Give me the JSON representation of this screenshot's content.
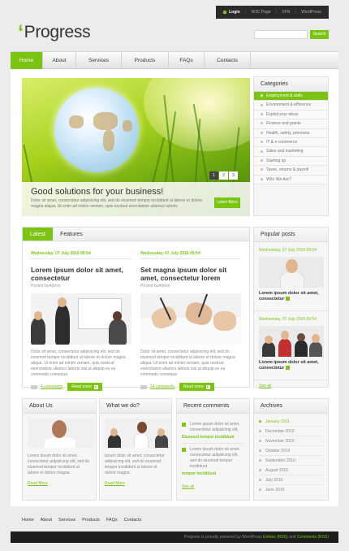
{
  "topbar": {
    "login": "Login",
    "links": [
      "W3C Page",
      "XFN",
      "WordPress"
    ]
  },
  "logo": {
    "mark": "‘",
    "text": "Progress"
  },
  "search": {
    "button": "Search",
    "placeholder": ""
  },
  "nav": [
    "Home",
    "About",
    "Services",
    "Products",
    "FAQs",
    "Contacts"
  ],
  "slider": {
    "title": "Good solutions for your business!",
    "text": "Dolor sit amet, consectetur adipisicing elit, sed do eiusmod tempor incididunt ut labore et dolore magna aliqua. Ut enim ad minim veniam, quis nostrud exercitation ullamco laboris",
    "button": "Learn More",
    "pages": [
      "1",
      "2",
      "3"
    ]
  },
  "categories": {
    "title": "Categories",
    "items": [
      "Employment & skills",
      "Environment & efficience",
      "Exploit your ideas",
      "Finance and grants",
      "Health, safety, premises",
      "IT & e-commerce",
      "Sales and marketing",
      "Starting up",
      "Taxes, returns & payroll",
      "Who We Are?"
    ]
  },
  "tabs": [
    "Latest",
    "Features"
  ],
  "posts": [
    {
      "date": "Wednesday, 07 July 2010 09:54",
      "title": "Lorem ipsum dolor sit amet, consectetur",
      "by": "Posted byAdmin",
      "text": "Dolor sit amet, consectetur adipisicing elit, sed do eiusmod tempor incididunt ut labore et dolore magna aliqua. Ut enim ad minim veniam, quis nostrud exercitation ullamco laboris nisi ut aliquip ex ea commodo consequa",
      "comments": "4 comments",
      "more": "Read more"
    },
    {
      "date": "Wednesday, 07 July 2010 09:54",
      "title": "Set magna ipsum dolor sit amet, consectetur lorem",
      "by": "Posted byAdmin",
      "text": "Dolor sit amet, consectetur adipisicing elit, sed do eiusmod tempor incididunt ut labore et dolore magna aliqua. Ut enim ad minim veniam, quis nostrud exercitation ullamco laboris nisi ut aliquip ex ea commodo consequa",
      "comments": "14 comments",
      "more": "Read more"
    }
  ],
  "popular": {
    "title": "Popular posts",
    "items": [
      {
        "date": "Wednesday, 07 July 2010 09:54",
        "title": "Lorem ipsum dolor sit amet, consectetur"
      },
      {
        "date": "Wednesday, 07 July 2010 09:54",
        "title": "Lorem ipsum dolor sit amet, consectetur"
      }
    ],
    "see_all": "See all"
  },
  "about": {
    "title": "About Us",
    "text": "Lorem ipsum dolor sit amet, consectetur adipisicing elit, sed do eiusmod tempor incididunt ut labore et dolore magna.",
    "more": "Read More"
  },
  "whatwedo": {
    "title": "What we do?",
    "text": "Ipsum dolor sit amet, consectetur adipisicing elit, sed do eiusmod tempor incididunt ut labore et dolore magna.",
    "more": "Read More"
  },
  "recent": {
    "title": "Recent comments",
    "items": [
      {
        "text": "Lorem ipsum dolor sit amet, consectetur adipisicing elit,",
        "by": "Eiusmod tempor incididunt"
      },
      {
        "text": "Lorem ipsum dolor sit amet, consectetur adipisicing elit, sed do eiusmod tempor incididunt",
        "by": "tempor incididunt"
      }
    ],
    "see_all": "See all"
  },
  "archives": {
    "title": "Archives",
    "items": [
      "January 2011",
      "December 2010",
      "November 2010",
      "October 2010",
      "September 2010",
      "August 2010",
      "July 2010",
      "June 2010"
    ]
  },
  "footnav": [
    "Home",
    "About",
    "Services",
    "Products",
    "FAQs",
    "Contacts"
  ],
  "footer": {
    "text1": "Progress",
    "text2": "is proudly powered by WordPress",
    "entries": "Entries (RSS)",
    "and": "and",
    "comments": "Comments (RSS)"
  },
  "colors": {
    "accent": "#7cc414",
    "dark": "#1d1d1d"
  }
}
